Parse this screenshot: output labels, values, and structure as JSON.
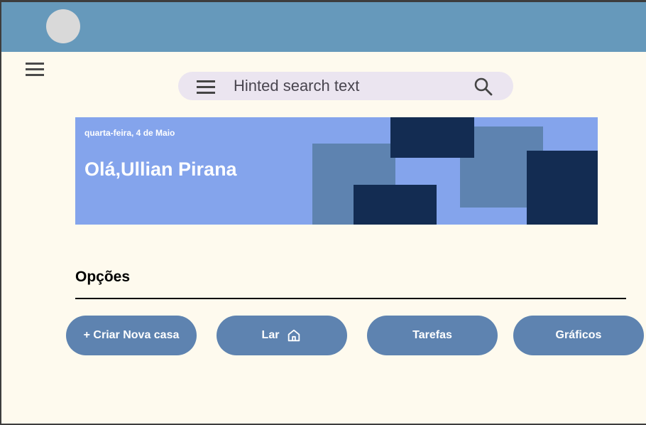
{
  "search": {
    "placeholder": "Hinted search text"
  },
  "banner": {
    "date": "quarta-feira, 4 de Maio",
    "greeting": "Olá,Ullian Pirana"
  },
  "options": {
    "title": "Opções",
    "buttons": [
      {
        "label": "+ Criar Nova casa"
      },
      {
        "label": "Lar",
        "icon": "home-icon"
      },
      {
        "label": "Tarefas"
      },
      {
        "label": "Gráficos"
      }
    ]
  },
  "colors": {
    "topbar": "#6699bb",
    "background": "#fefaee",
    "banner": "#84a4ec",
    "banner_block_mid": "#5e83b0",
    "banner_block_dark": "#132c52",
    "button": "#5e83b0"
  }
}
